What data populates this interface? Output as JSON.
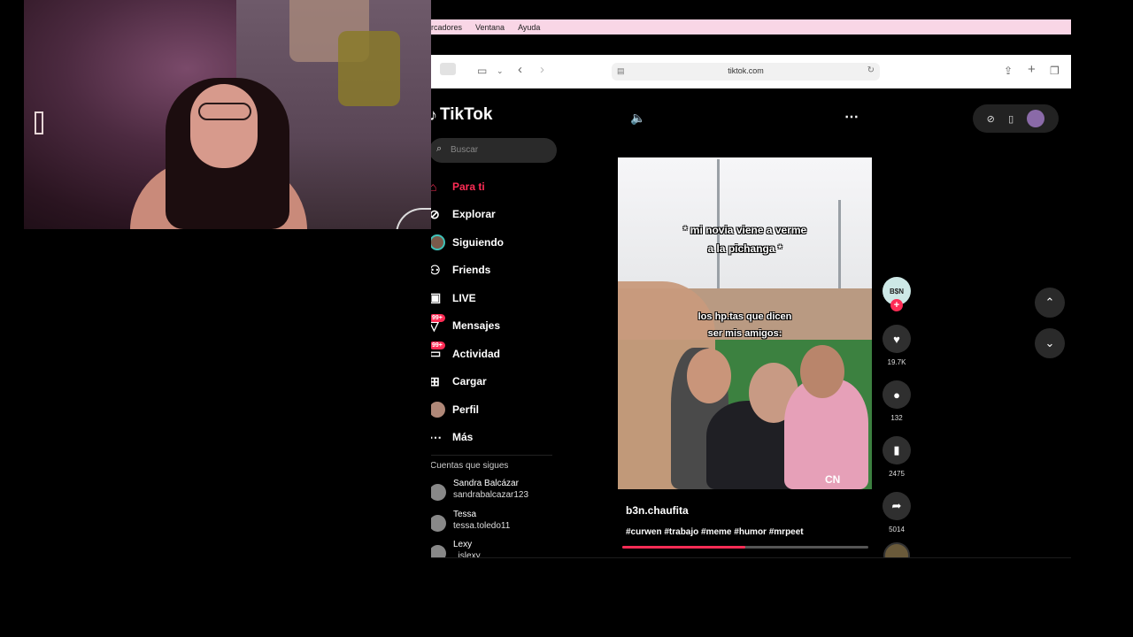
{
  "browser": {
    "menu": [
      "rcadores",
      "Ventana",
      "Ayuda"
    ],
    "url": "tiktok.com"
  },
  "tiktok": {
    "logo": "TikTok",
    "search_placeholder": "Buscar",
    "nav": [
      {
        "label": "Para ti",
        "icon": "home-icon",
        "active": true
      },
      {
        "label": "Explorar",
        "icon": "compass-icon"
      },
      {
        "label": "Siguiendo",
        "icon": "following-avatar"
      },
      {
        "label": "Friends",
        "icon": "friends-icon"
      },
      {
        "label": "LIVE",
        "icon": "live-icon"
      },
      {
        "label": "Mensajes",
        "icon": "messages-icon",
        "badge": "99+"
      },
      {
        "label": "Actividad",
        "icon": "activity-icon",
        "badge": "99+"
      },
      {
        "label": "Cargar",
        "icon": "upload-icon"
      },
      {
        "label": "Perfil",
        "icon": "profile-avatar"
      },
      {
        "label": "Más",
        "icon": "more-icon"
      }
    ],
    "following_title": "Cuentas que sigues",
    "following": [
      {
        "name": "Sandra Balcázar",
        "user": "sandrabalcazar123"
      },
      {
        "name": "Tessa",
        "user": "tessa.toledo11"
      },
      {
        "name": "Lexy",
        "user": "_islexy"
      }
    ],
    "video": {
      "caption_top_1": "* mi novia viene a verme",
      "caption_top_2": "a la pichanga *",
      "caption_mid_1": "los hp.tas que dicen",
      "caption_mid_2": "ser mis amigos:",
      "watermark": "CN",
      "author": "b3n.chaufita",
      "hashtags": "#curwen #trabajo #meme #humor #mrpeet",
      "progress": 0.5
    },
    "creator_avatar_text": "B$N",
    "actions": {
      "likes": "19.7K",
      "comments": "132",
      "saves": "2475",
      "shares": "5014"
    }
  },
  "colors": {
    "accent": "#fe2c55",
    "menubar": "#f9d6e6",
    "page_bg": "#000000"
  }
}
